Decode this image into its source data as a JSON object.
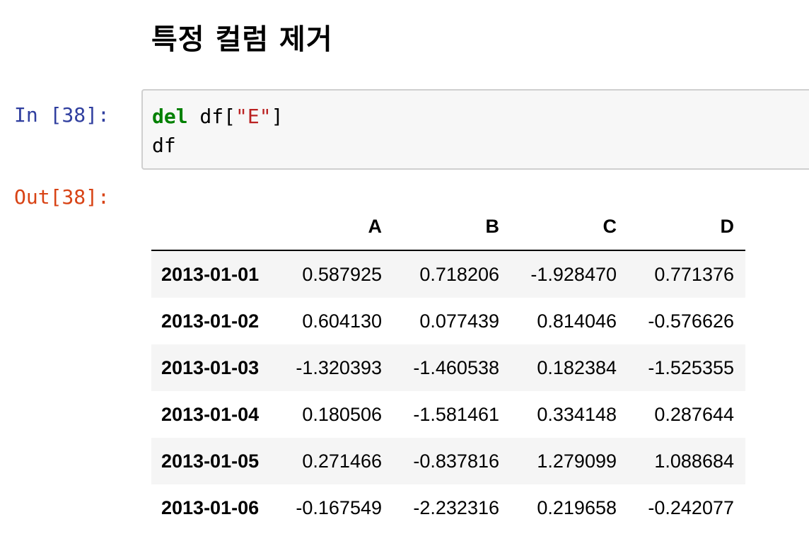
{
  "heading": "특정 컬럼 제거",
  "cell": {
    "in_prompt": "In [38]:",
    "out_prompt": "Out[38]:",
    "code": {
      "kw": "del",
      "line1_a": " df[",
      "str": "\"E\"",
      "line1_b": "]",
      "line2": "df"
    }
  },
  "table": {
    "columns": [
      "A",
      "B",
      "C",
      "D"
    ],
    "rows": [
      {
        "index": "2013-01-01",
        "values": [
          "0.587925",
          "0.718206",
          "-1.928470",
          "0.771376"
        ]
      },
      {
        "index": "2013-01-02",
        "values": [
          "0.604130",
          "0.077439",
          "0.814046",
          "-0.576626"
        ]
      },
      {
        "index": "2013-01-03",
        "values": [
          "-1.320393",
          "-1.460538",
          "0.182384",
          "-1.525355"
        ]
      },
      {
        "index": "2013-01-04",
        "values": [
          "0.180506",
          "-1.581461",
          "0.334148",
          "0.287644"
        ]
      },
      {
        "index": "2013-01-05",
        "values": [
          "0.271466",
          "-0.837816",
          "1.279099",
          "1.088684"
        ]
      },
      {
        "index": "2013-01-06",
        "values": [
          "-0.167549",
          "-2.232316",
          "0.219658",
          "-0.242077"
        ]
      }
    ]
  }
}
